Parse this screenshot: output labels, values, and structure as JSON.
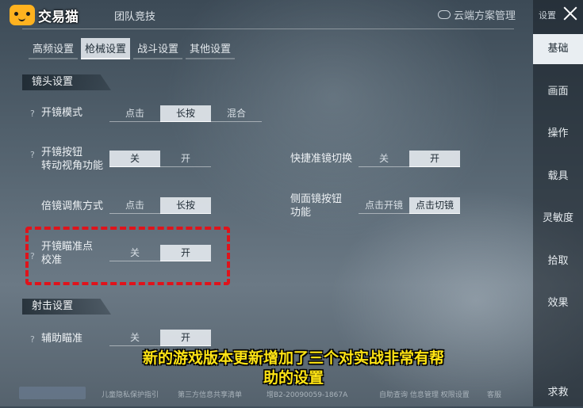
{
  "header": {
    "logo_text": "交易猫",
    "tab_team": "团队竞技",
    "cloud_label": "云端方案管理"
  },
  "subtabs": [
    "高频设置",
    "枪械设置",
    "战斗设置",
    "其他设置"
  ],
  "active_subtab": "枪械设置",
  "sections": {
    "lens": "镜头设置",
    "shoot": "射击设置"
  },
  "settings": {
    "scope_mode": {
      "label": "开镜模式",
      "options": [
        "点击",
        "长按",
        "混合"
      ],
      "selected": "长按"
    },
    "scope_button_rotate": {
      "label_line1": "开镜按钮",
      "label_line2": "转动视角功能",
      "options": [
        "关",
        "开"
      ],
      "selected": "关"
    },
    "quick_scope_switch": {
      "label": "快捷准镜切换",
      "options": [
        "关",
        "开"
      ],
      "selected": "开"
    },
    "zoom_focus": {
      "label": "倍镜调焦方式",
      "options": [
        "点击",
        "长按"
      ],
      "selected": "长按"
    },
    "side_scope_button": {
      "label_line1": "侧面镜按钮",
      "label_line2": "功能",
      "options": [
        "点击开镜",
        "点击切镜"
      ],
      "selected": "点击切镜"
    },
    "aim_calibration": {
      "label_line1": "开镜瞄准点",
      "label_line2": "校准",
      "options": [
        "关",
        "开"
      ],
      "selected": "开"
    },
    "aim_assist": {
      "label": "辅助瞄准",
      "options": [
        "关",
        "开"
      ],
      "selected": "开"
    }
  },
  "question_mark": "?",
  "sidebar": {
    "title": "设置",
    "items": [
      "基础",
      "画面",
      "操作",
      "载具",
      "灵敏度",
      "拾取",
      "效果",
      "求救"
    ],
    "active": "基础"
  },
  "footer": {
    "privacy_child": "儿童隐私保护指引",
    "third_party": "第三方信息共享清单",
    "license": "增B2-20090059-1867A",
    "help": "自助查询 信息管理 权限设置",
    "service": "客服"
  },
  "caption": {
    "line1": "新的游戏版本更新增加了三个对实战非常有帮",
    "line2": "助的设置"
  },
  "colors": {
    "highlight_border": "#e0131b",
    "caption_text": "#ffe414",
    "logo_bg": "#ffb21f"
  }
}
